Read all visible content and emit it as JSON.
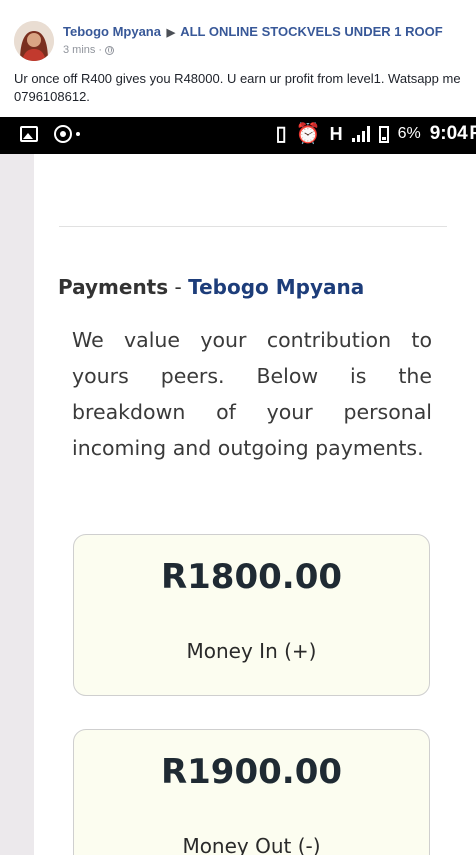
{
  "post": {
    "author": "Tebogo Mpyana",
    "group": "ALL ONLINE STOCKVELS UNDER 1 ROOF",
    "time": "3 mins",
    "text": "Ur once off R400 gives you R48000. U earn ur profit from level1. Watsapp me 0796108612."
  },
  "status_bar": {
    "network": "H",
    "battery_percent": "6%",
    "time": "9:04",
    "time_suffix": "P"
  },
  "payments": {
    "heading": "Payments",
    "separator": " - ",
    "user_name": "Tebogo Mpyana",
    "description": "We value your contribution to yours peers. Below is the breakdown of your personal incoming and outgoing payments.",
    "money_in": {
      "amount": "R1800.00",
      "label": "Money In (+)"
    },
    "money_out": {
      "amount": "R1900.00",
      "label": "Money Out (-)"
    }
  },
  "colors": {
    "author_link": "#385898",
    "user_name": "#1d3d7a",
    "box_background": "#fcfdf0"
  }
}
